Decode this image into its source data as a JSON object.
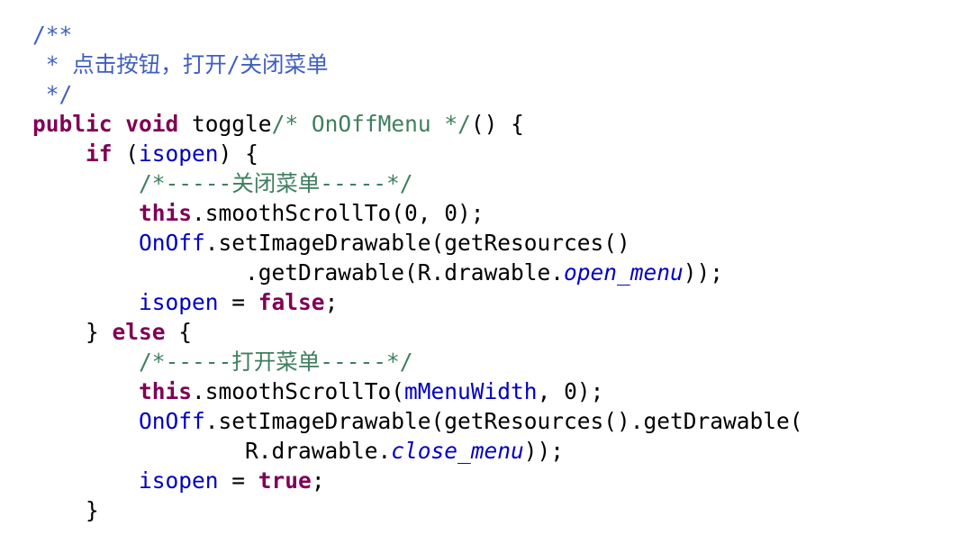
{
  "colors": {
    "kw": "#7F0055",
    "doc": "#3F5FBF",
    "cm": "#3F7F5F",
    "fld": "#0000C0",
    "st": "#0000C0",
    "pl": "#000000"
  },
  "lines": [
    [
      [
        "doc",
        "/**"
      ]
    ],
    [
      [
        "doc",
        " * 点击按钮，打开/关闭菜单"
      ]
    ],
    [
      [
        "doc",
        " */"
      ]
    ],
    [
      [
        "kw",
        "public"
      ],
      [
        "pl",
        " "
      ],
      [
        "kw",
        "void"
      ],
      [
        "pl",
        " toggle"
      ],
      [
        "cm",
        "/* OnOffMenu */"
      ],
      [
        "pl",
        "() {"
      ]
    ],
    [
      [
        "pl",
        "    "
      ],
      [
        "kw",
        "if"
      ],
      [
        "pl",
        " ("
      ],
      [
        "fld",
        "isopen"
      ],
      [
        "pl",
        ") {"
      ]
    ],
    [
      [
        "pl",
        "        "
      ],
      [
        "cm",
        "/*-----关闭菜单-----*/"
      ]
    ],
    [
      [
        "pl",
        "        "
      ],
      [
        "kw",
        "this"
      ],
      [
        "pl",
        ".smoothScrollTo(0, 0);"
      ]
    ],
    [
      [
        "pl",
        "        "
      ],
      [
        "fld",
        "OnOff"
      ],
      [
        "pl",
        ".setImageDrawable(getResources()"
      ]
    ],
    [
      [
        "pl",
        "                .getDrawable(R.drawable."
      ],
      [
        "st",
        "open_menu"
      ],
      [
        "pl",
        "));"
      ]
    ],
    [
      [
        "pl",
        "        "
      ],
      [
        "fld",
        "isopen"
      ],
      [
        "pl",
        " = "
      ],
      [
        "kw",
        "false"
      ],
      [
        "pl",
        ";"
      ]
    ],
    [
      [
        "pl",
        "    } "
      ],
      [
        "kw",
        "else"
      ],
      [
        "pl",
        " {"
      ]
    ],
    [
      [
        "pl",
        "        "
      ],
      [
        "cm",
        "/*-----打开菜单-----*/"
      ]
    ],
    [
      [
        "pl",
        "        "
      ],
      [
        "kw",
        "this"
      ],
      [
        "pl",
        ".smoothScrollTo("
      ],
      [
        "fld",
        "mMenuWidth"
      ],
      [
        "pl",
        ", 0);"
      ]
    ],
    [
      [
        "pl",
        "        "
      ],
      [
        "fld",
        "OnOff"
      ],
      [
        "pl",
        ".setImageDrawable(getResources().getDrawable("
      ]
    ],
    [
      [
        "pl",
        "                R.drawable."
      ],
      [
        "st",
        "close_menu"
      ],
      [
        "pl",
        "));"
      ]
    ],
    [
      [
        "pl",
        "        "
      ],
      [
        "fld",
        "isopen"
      ],
      [
        "pl",
        " = "
      ],
      [
        "kw",
        "true"
      ],
      [
        "pl",
        ";"
      ]
    ],
    [
      [
        "pl",
        "    }"
      ]
    ]
  ]
}
